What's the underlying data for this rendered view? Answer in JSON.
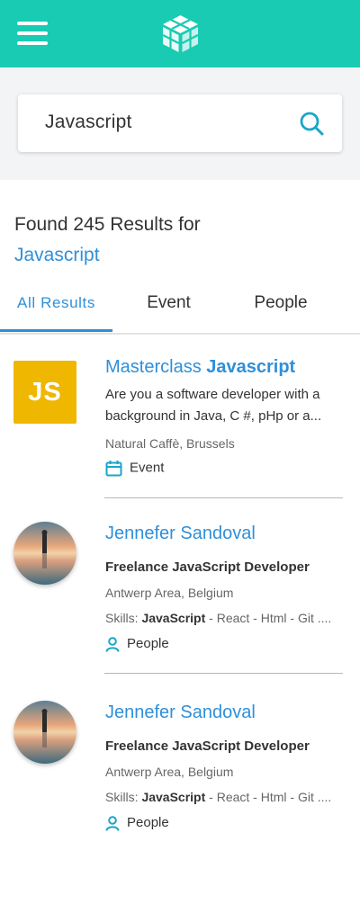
{
  "colors": {
    "brand": "#19cbb3",
    "accent": "#2f8fd9",
    "js_badge": "#efb700"
  },
  "header": {
    "menu_icon": "hamburger-icon",
    "logo_icon": "cube-logo-icon"
  },
  "search": {
    "value": "Javascript",
    "icon": "search-icon"
  },
  "results_summary": {
    "prefix": "Found 245 Results for",
    "query": "Javascript"
  },
  "tabs": [
    {
      "label": "All Results",
      "active": true
    },
    {
      "label": "Event",
      "active": false
    },
    {
      "label": "People",
      "active": false
    }
  ],
  "results": [
    {
      "thumb_text": "JS",
      "title_plain": "Masterclass ",
      "title_bold": "Javascript",
      "description": "Are you a software developer with a background in Java, C #, pHp or a...",
      "location": "Natural Caffè, Brussels",
      "type_label": "Event",
      "type_icon": "calendar-icon"
    },
    {
      "name": "Jennefer Sandoval",
      "role_pre": "Freelance ",
      "role_bold": "JavaScript",
      "role_post": " Developer",
      "location": "Antwerp Area, Belgium",
      "skills_label": "Skills: ",
      "skills_bold": "JavaScript",
      "skills_rest": " - React - Html - Git ....",
      "type_label": "People",
      "type_icon": "person-icon"
    },
    {
      "name": "Jennefer Sandoval",
      "role_pre": "Freelance ",
      "role_bold": "JavaScript",
      "role_post": " Developer",
      "location": "Antwerp Area, Belgium",
      "skills_label": "Skills: ",
      "skills_bold": "JavaScript",
      "skills_rest": " - React - Html - Git ....",
      "type_label": "People",
      "type_icon": "person-icon"
    }
  ]
}
